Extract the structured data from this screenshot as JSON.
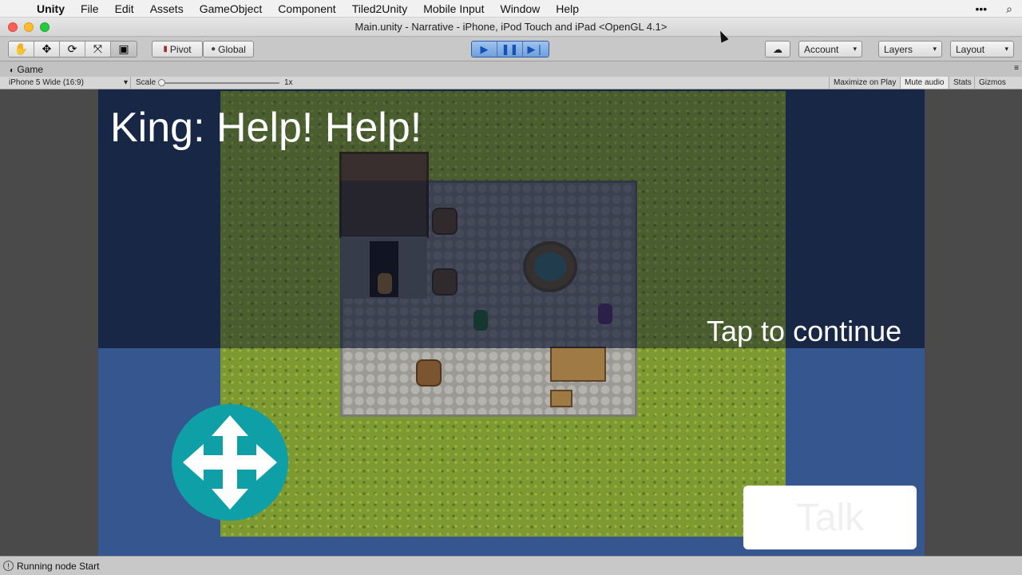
{
  "menubar": {
    "app": "Unity",
    "items": [
      "File",
      "Edit",
      "Assets",
      "GameObject",
      "Component",
      "Tiled2Unity",
      "Mobile Input",
      "Window",
      "Help"
    ]
  },
  "window": {
    "title": "Main.unity - Narrative - iPhone, iPod Touch and iPad <OpenGL 4.1>"
  },
  "toolbar": {
    "pivot": "Pivot",
    "global": "Global",
    "account": "Account",
    "layers": "Layers",
    "layout": "Layout"
  },
  "game_tab": {
    "label": "Game",
    "resolution": "iPhone 5 Wide (16:9)",
    "scale_label": "Scale",
    "scale_value": "1x",
    "maximize": "Maximize on Play",
    "mute": "Mute audio",
    "stats": "Stats",
    "gizmos": "Gizmos"
  },
  "game": {
    "dialogue": "King: Help! Help!",
    "tap_hint": "Tap to continue",
    "talk_button": "Talk"
  },
  "status": {
    "message": "Running node Start"
  },
  "colors": {
    "dpad": "#0f9fa6",
    "play_accent": "#1450b8"
  }
}
